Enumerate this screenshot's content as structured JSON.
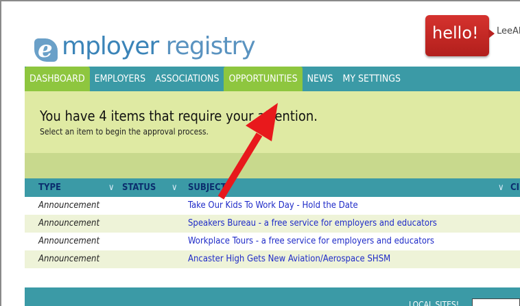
{
  "logo": {
    "first": "mployer",
    "second": "registry"
  },
  "greeting": {
    "text": "hello!",
    "user": "LeeAl"
  },
  "nav": {
    "items": [
      {
        "label": "DASHBOARD",
        "state": "active"
      },
      {
        "label": "EMPLOYERS",
        "state": "normal"
      },
      {
        "label": "ASSOCIATIONS",
        "state": "normal"
      },
      {
        "label": "OPPORTUNITIES",
        "state": "highlighted"
      },
      {
        "label": "NEWS",
        "state": "normal"
      },
      {
        "label": "MY SETTINGS",
        "state": "normal"
      }
    ]
  },
  "attention": {
    "title": "You have 4 items that require your attention.",
    "subtitle": "Select an item to begin the approval process."
  },
  "table": {
    "headers": [
      "TYPE",
      "STATUS",
      "SUBJECT",
      "CI"
    ],
    "rows": [
      {
        "type": "Announcement",
        "status": "",
        "subject": "Take Our Kids To Work Day - Hold the Date"
      },
      {
        "type": "Announcement",
        "status": "",
        "subject": "Speakers Bureau - a free service for employers and educators"
      },
      {
        "type": "Announcement",
        "status": "",
        "subject": "Workplace Tours - a free service for employers and educators"
      },
      {
        "type": "Announcement",
        "status": "",
        "subject": "Ancaster High Gets New Aviation/Aerospace SHSM"
      }
    ]
  },
  "footer": {
    "local_sites": "LOCAL SITES!"
  },
  "colors": {
    "nav_bg": "#3b9aa6",
    "nav_active": "#8ec63f",
    "attention_bg": "#dfeaa3",
    "link": "#1f2bc8",
    "annotation_arrow": "#e8191c"
  }
}
